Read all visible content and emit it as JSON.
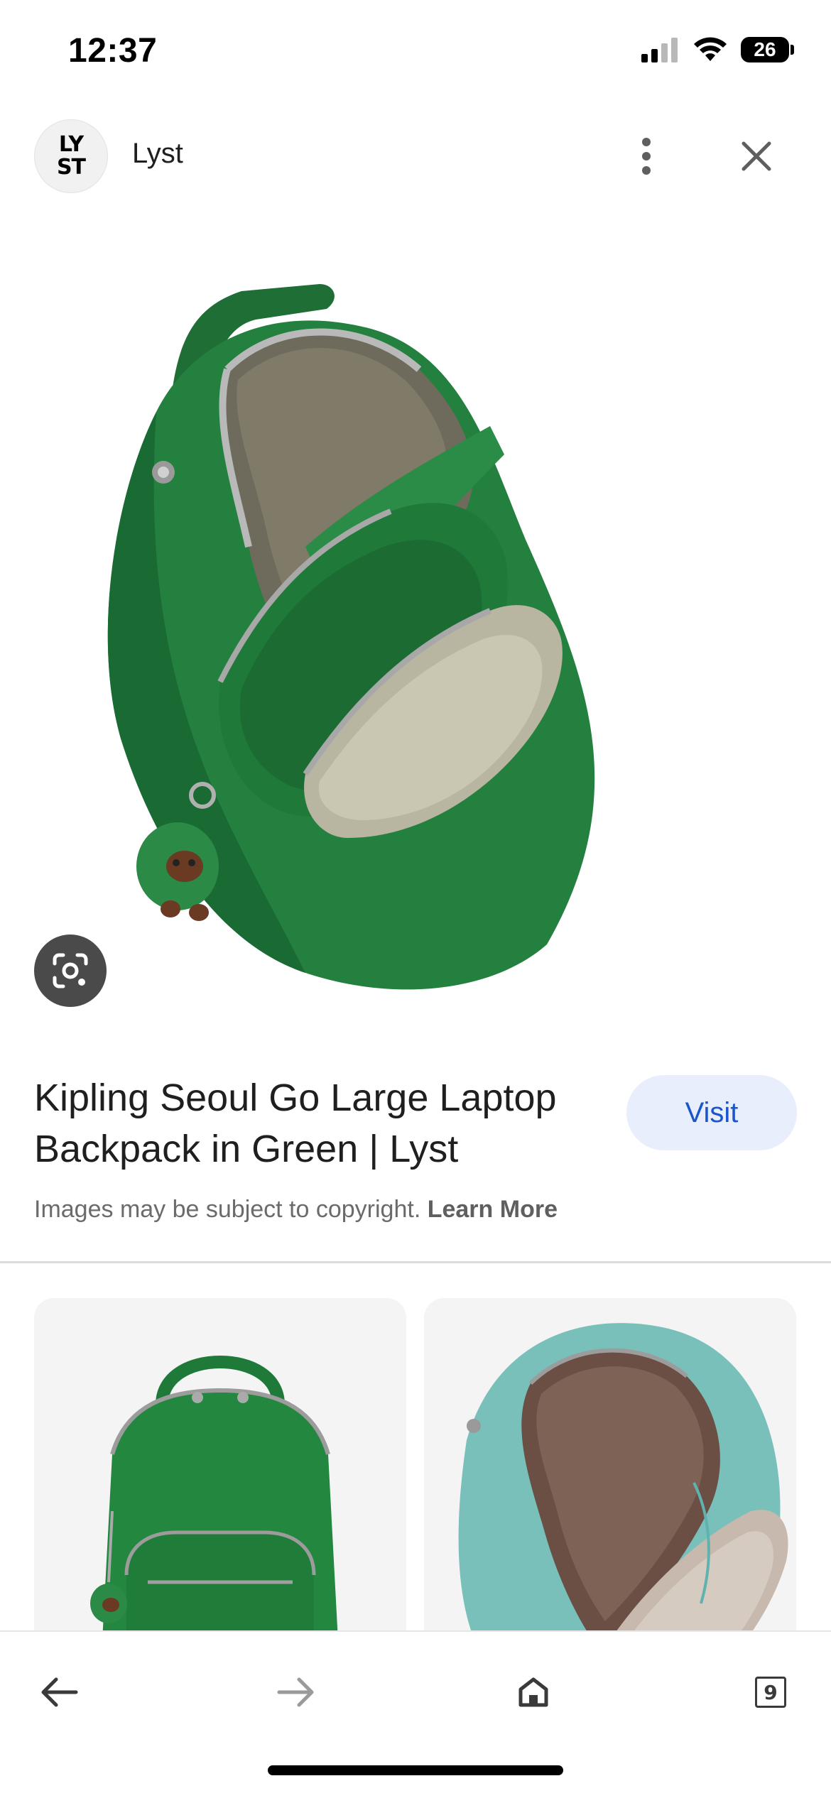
{
  "status_bar": {
    "time": "12:37",
    "battery": "26",
    "icons": [
      "cellular-signal-icon",
      "wifi-icon",
      "battery-icon"
    ]
  },
  "header": {
    "site_logo_text": "LYST",
    "site_name": "Lyst",
    "more_icon": "more-vertical-icon",
    "close_icon": "close-icon"
  },
  "hero": {
    "image": "green-backpack-open-image",
    "lens_icon": "lens-icon"
  },
  "result": {
    "title": "Kipling Seoul Go Large Laptop Backpack in Green | Lyst",
    "visit_label": "Visit",
    "copyright_text": "Images may be subject to copyright.",
    "learn_more_label": "Learn More"
  },
  "related": [
    {
      "image": "green-backpack-front-image"
    },
    {
      "image": "teal-backpack-open-image"
    }
  ],
  "bottom_bar": {
    "back_icon": "arrow-left-icon",
    "forward_icon": "arrow-right-icon",
    "home_icon": "home-icon",
    "tab_count": "9"
  },
  "colors": {
    "accent": "#1a56c9",
    "visit_bg": "#e8eefc",
    "backpack_green": "#1f7a3c",
    "teal": "#6fb9b6"
  }
}
